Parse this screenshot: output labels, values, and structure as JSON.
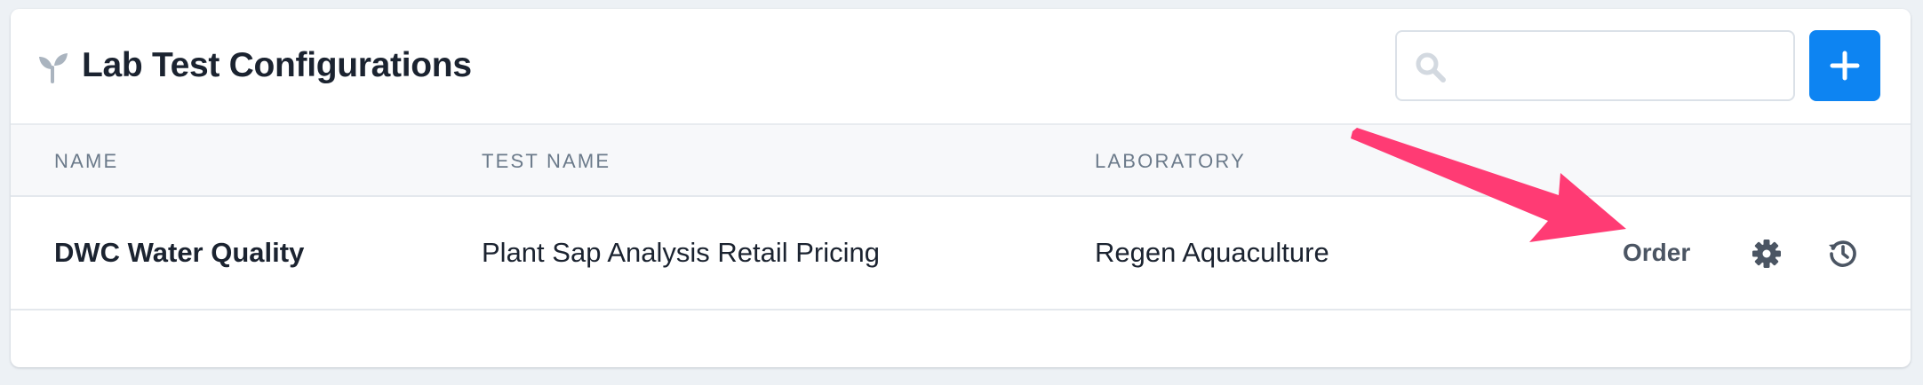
{
  "header": {
    "title": "Lab Test Configurations",
    "title_icon": "seedling-icon",
    "search": {
      "placeholder": "",
      "value": "",
      "icon": "search-icon"
    },
    "add_button_icon": "plus-icon"
  },
  "table": {
    "columns": [
      "NAME",
      "TEST NAME",
      "LABORATORY"
    ],
    "rows": [
      {
        "name": "DWC Water Quality",
        "test_name": "Plant Sap Analysis Retail Pricing",
        "laboratory": "Regen Aquaculture",
        "actions": {
          "order_label": "Order",
          "settings_icon": "gear-icon",
          "history_icon": "history-icon"
        }
      }
    ]
  },
  "annotation": {
    "type": "arrow",
    "color": "#ff3b74",
    "points_to": "order-link"
  },
  "colors": {
    "accent": "#0d84f2",
    "title": "#1b2330",
    "header_text": "#6b7a8a"
  }
}
